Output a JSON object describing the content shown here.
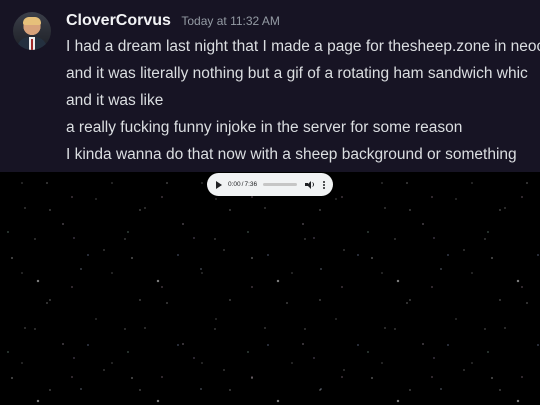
{
  "message": {
    "author": "CloverCorvus",
    "timestamp": "Today at 11:32 AM",
    "lines": [
      "I had a dream last night that I made a page for thesheep.zone in neoc",
      "and it was literally nothing but a gif of a rotating ham sandwich whic",
      "and it was like",
      "a really fucking funny injoke in the server for some reason",
      "I kinda wanna do that now with a sheep background or something"
    ]
  },
  "audio_player": {
    "current_time": "0:00",
    "separator": "/",
    "duration": "7:36",
    "progress": 0.0,
    "icons": {
      "play": "play-icon",
      "volume": "volume-icon",
      "more": "more-options-icon"
    }
  },
  "colors": {
    "message_bg": "#171424",
    "username": "#f2f3f5",
    "timestamp": "#949ba4",
    "message_text": "#dbdee1",
    "player_bg": "#f1f3f4",
    "page_bg": "#000000"
  }
}
